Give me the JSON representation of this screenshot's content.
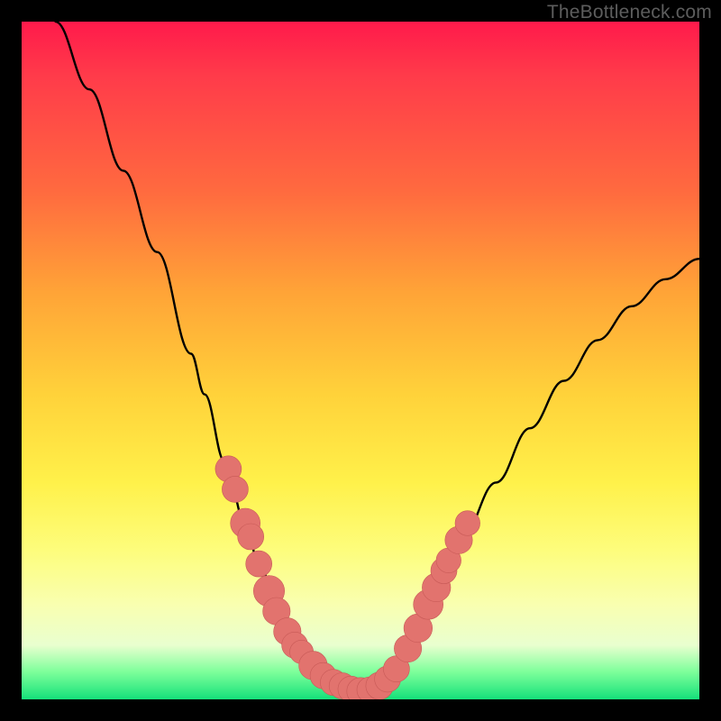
{
  "attribution": "TheBottleneck.com",
  "colors": {
    "frame": "#000000",
    "gradient_top": "#ff1a4b",
    "gradient_mid": "#ffd23a",
    "gradient_bottom": "#15e07a",
    "curve": "#000000",
    "marker_fill": "#e2736e",
    "marker_stroke": "#c85a57"
  },
  "chart_data": {
    "type": "line",
    "title": "",
    "xlabel": "",
    "ylabel": "",
    "xlim": [
      0,
      100
    ],
    "ylim": [
      0,
      100
    ],
    "series": [
      {
        "name": "bottleneck-curve",
        "x": [
          5,
          10,
          15,
          20,
          25,
          27,
          30,
          33,
          35,
          38,
          40,
          43,
          45,
          47,
          50,
          53,
          55,
          58,
          60,
          65,
          70,
          75,
          80,
          85,
          90,
          95,
          100
        ],
        "y": [
          100,
          90,
          78,
          66,
          51,
          45,
          35,
          26,
          20,
          13,
          9,
          5,
          3,
          2,
          1,
          2,
          4,
          9,
          14,
          24,
          32,
          40,
          47,
          53,
          58,
          62,
          65
        ]
      }
    ],
    "markers": [
      {
        "x": 30.5,
        "y": 34,
        "r": 1.4
      },
      {
        "x": 31.5,
        "y": 31,
        "r": 1.4
      },
      {
        "x": 33.0,
        "y": 26,
        "r": 1.7
      },
      {
        "x": 33.8,
        "y": 24,
        "r": 1.4
      },
      {
        "x": 35.0,
        "y": 20,
        "r": 1.4
      },
      {
        "x": 36.5,
        "y": 16,
        "r": 1.8
      },
      {
        "x": 37.6,
        "y": 13,
        "r": 1.5
      },
      {
        "x": 39.2,
        "y": 10,
        "r": 1.5
      },
      {
        "x": 40.3,
        "y": 8,
        "r": 1.4
      },
      {
        "x": 41.3,
        "y": 7,
        "r": 1.2
      },
      {
        "x": 43.0,
        "y": 5,
        "r": 1.6
      },
      {
        "x": 44.5,
        "y": 3.5,
        "r": 1.4
      },
      {
        "x": 46.0,
        "y": 2.5,
        "r": 1.4
      },
      {
        "x": 47.3,
        "y": 2.0,
        "r": 1.4
      },
      {
        "x": 48.6,
        "y": 1.5,
        "r": 1.4
      },
      {
        "x": 50.0,
        "y": 1.2,
        "r": 1.5
      },
      {
        "x": 51.4,
        "y": 1.4,
        "r": 1.4
      },
      {
        "x": 52.8,
        "y": 2.0,
        "r": 1.5
      },
      {
        "x": 54.0,
        "y": 3.0,
        "r": 1.4
      },
      {
        "x": 55.3,
        "y": 4.5,
        "r": 1.4
      },
      {
        "x": 57.0,
        "y": 7.5,
        "r": 1.5
      },
      {
        "x": 58.5,
        "y": 10.5,
        "r": 1.6
      },
      {
        "x": 60.0,
        "y": 14,
        "r": 1.7
      },
      {
        "x": 61.2,
        "y": 16.5,
        "r": 1.6
      },
      {
        "x": 62.3,
        "y": 19,
        "r": 1.4
      },
      {
        "x": 63.0,
        "y": 20.5,
        "r": 1.3
      },
      {
        "x": 64.5,
        "y": 23.5,
        "r": 1.5
      },
      {
        "x": 65.8,
        "y": 26,
        "r": 1.3
      }
    ],
    "annotations": []
  }
}
